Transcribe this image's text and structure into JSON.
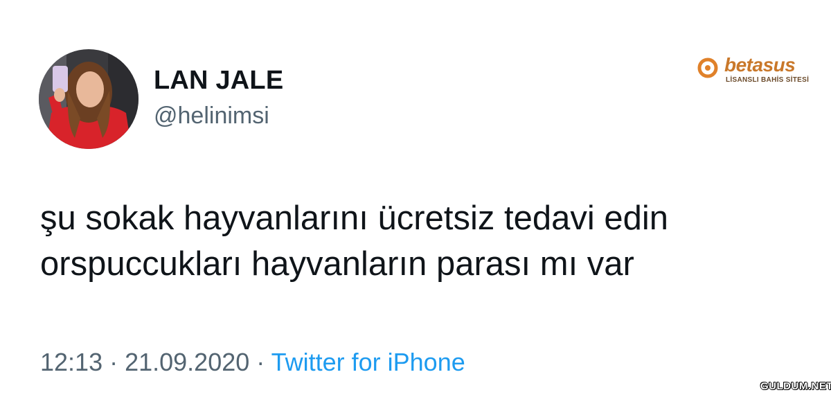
{
  "user": {
    "display_name": "LAN JALE",
    "handle": "@helinimsi"
  },
  "tweet": {
    "line1": "şu sokak hayvanlarını ücretsiz tedavi edin",
    "line2": "orspuccukları hayvanların parası mı var"
  },
  "meta": {
    "time": "12:13",
    "separator1": " · ",
    "date": "21.09.2020",
    "separator2": " · ",
    "source": "Twitter for iPhone"
  },
  "brand": {
    "name": "betasus",
    "tagline": "LİSANSLI BAHİS SİTESİ"
  },
  "watermark": "GULDUM.NET",
  "colors": {
    "text": "#0f1419",
    "secondary": "#536471",
    "link": "#1d9bf0",
    "brand": "#c9782a"
  }
}
